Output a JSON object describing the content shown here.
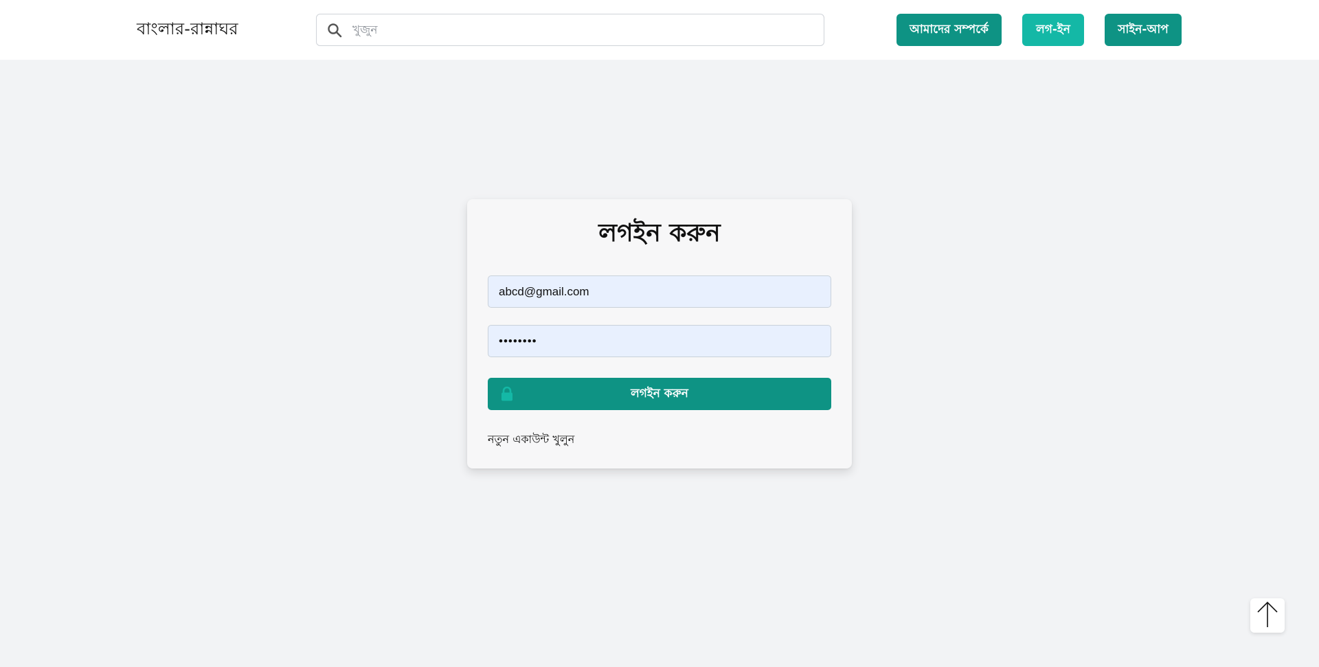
{
  "header": {
    "brand": "বাংলার-রান্নাঘর",
    "search": {
      "placeholder": "খুজুন",
      "value": "",
      "icon": "search-icon"
    },
    "buttons": {
      "about": "আমাদের সম্পর্কে",
      "login": "লগ-ইন",
      "signup": "সাইন-আপ"
    }
  },
  "login_form": {
    "title": "লগইন করুন",
    "email_value": "abcd@gmail.com",
    "password_value": "••••••••",
    "submit_label": "লগইন করুন",
    "submit_icon": "lock-icon",
    "signup_link": "নতুন একাউন্ট খুলুন"
  },
  "scroll_top": {
    "icon": "arrow-up-icon"
  },
  "colors": {
    "primary": "#0e9384",
    "primary_light": "#14b8a6",
    "page_bg": "#f2f3f5",
    "input_bg": "#e8f0fe"
  }
}
